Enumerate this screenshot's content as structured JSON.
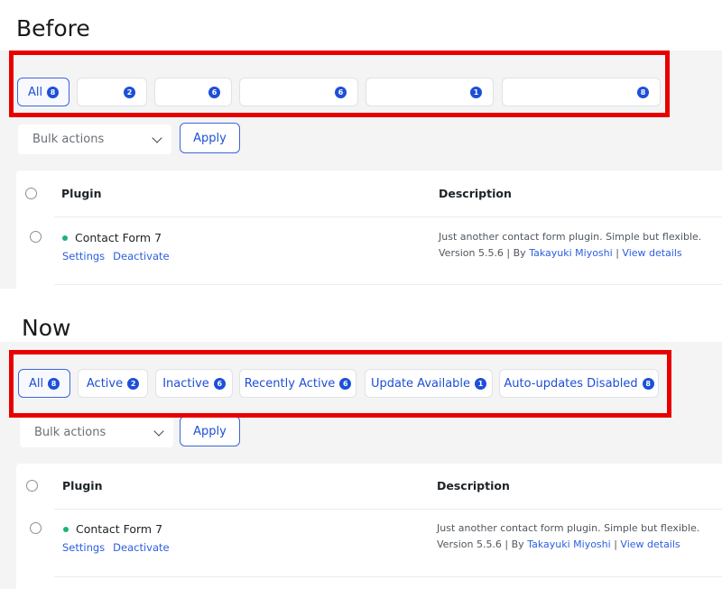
{
  "before": {
    "heading": "Before",
    "filters": [
      {
        "label": "All",
        "count": "8"
      },
      {
        "label": "",
        "count": "2"
      },
      {
        "label": "",
        "count": "6"
      },
      {
        "label": "",
        "count": "6"
      },
      {
        "label": "",
        "count": "1"
      },
      {
        "label": "",
        "count": "8"
      }
    ]
  },
  "now": {
    "heading": "Now",
    "filters": [
      {
        "label": "All",
        "count": "8"
      },
      {
        "label": "Active",
        "count": "2"
      },
      {
        "label": "Inactive",
        "count": "6"
      },
      {
        "label": "Recently Active",
        "count": "6"
      },
      {
        "label": "Update Available",
        "count": "1"
      },
      {
        "label": "Auto-updates Disabled",
        "count": "8"
      }
    ]
  },
  "bulk": {
    "placeholder": "Bulk actions",
    "apply": "Apply"
  },
  "table": {
    "col_plugin": "Plugin",
    "col_description": "Description",
    "row": {
      "name": "Contact Form 7",
      "action_settings": "Settings",
      "action_deactivate": "Deactivate",
      "description": "Just another contact form plugin. Simple but flexible.",
      "version_prefix": "Version 5.5.6 | By ",
      "author": "Takayuki Miyoshi",
      "separator": " | ",
      "view_details": "View details"
    }
  },
  "colors": {
    "highlight": "#e80000",
    "accent": "#1d4fd7",
    "active_dot": "#1bb37a"
  }
}
